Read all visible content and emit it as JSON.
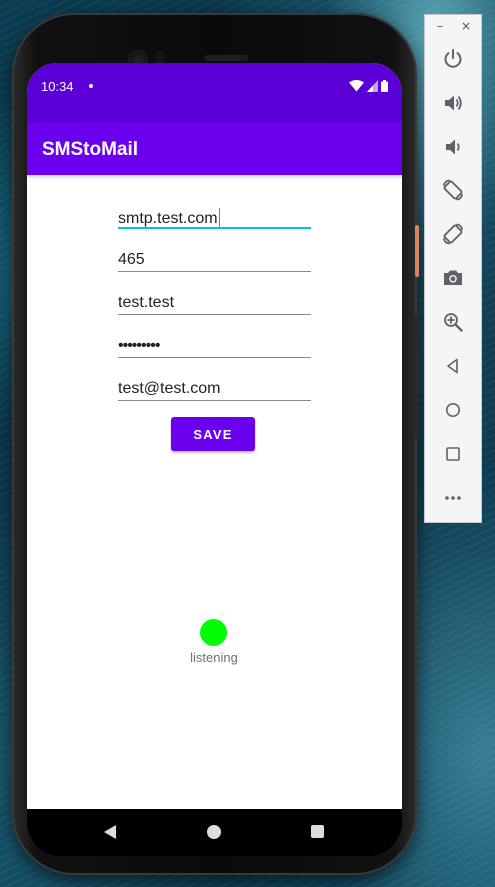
{
  "status_bar": {
    "time": "10:34"
  },
  "app_bar": {
    "title": "SMStoMail"
  },
  "form": {
    "smtp_host": "smtp.test.com",
    "smtp_port": "465",
    "username": "test.test",
    "password_masked": "•••••••••",
    "email": "test@test.com",
    "save_label": "SAVE"
  },
  "status": {
    "label": "listening",
    "indicator_color": "#00ff00"
  },
  "colors": {
    "primary": "#6a00ee",
    "primary_dark": "#5a00d6",
    "accent": "#00c8c8"
  },
  "emulator_toolbar": {
    "minimize_label": "–",
    "close_label": "×",
    "buttons": [
      {
        "name": "power-icon"
      },
      {
        "name": "volume-up-icon"
      },
      {
        "name": "volume-down-icon"
      },
      {
        "name": "rotate-left-icon"
      },
      {
        "name": "rotate-right-icon"
      },
      {
        "name": "camera-icon"
      },
      {
        "name": "zoom-icon"
      },
      {
        "name": "back-icon"
      },
      {
        "name": "home-icon"
      },
      {
        "name": "overview-icon"
      },
      {
        "name": "more-icon"
      }
    ]
  }
}
